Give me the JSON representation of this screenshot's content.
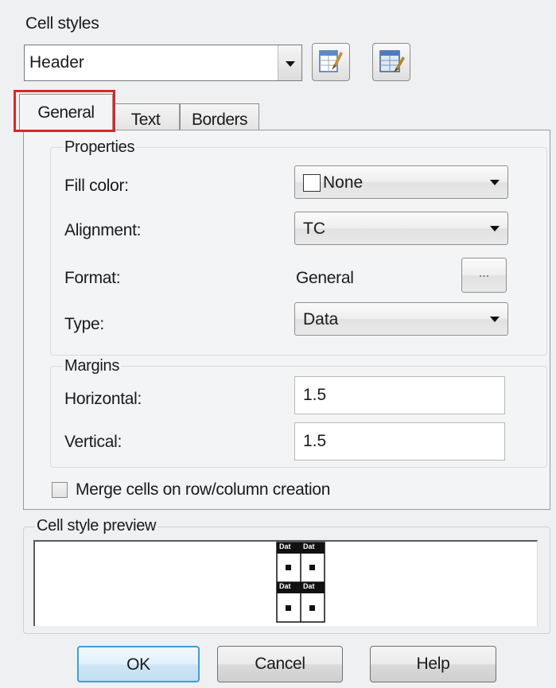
{
  "cell_styles": {
    "title": "Cell styles",
    "selected": "Header"
  },
  "tabs": [
    {
      "label": "General"
    },
    {
      "label": "Text"
    },
    {
      "label": "Borders"
    }
  ],
  "properties": {
    "title": "Properties",
    "fill_color": {
      "label": "Fill color:",
      "value": "None"
    },
    "alignment": {
      "label": "Alignment:",
      "value": "TC"
    },
    "format": {
      "label": "Format:",
      "value": "General",
      "button": "..."
    },
    "type": {
      "label": "Type:",
      "value": "Data"
    }
  },
  "margins": {
    "title": "Margins",
    "horizontal": {
      "label": "Horizontal:",
      "value": "1.5"
    },
    "vertical": {
      "label": "Vertical:",
      "value": "1.5"
    }
  },
  "merge_cells": {
    "label": "Merge cells on row/column creation",
    "checked": false
  },
  "preview": {
    "title": "Cell style preview",
    "cell_text": "Dat"
  },
  "buttons": {
    "ok": "OK",
    "cancel": "Cancel",
    "help": "Help"
  },
  "colors": {
    "highlight": "#d9262b",
    "ok_border": "#3c9ed8"
  }
}
